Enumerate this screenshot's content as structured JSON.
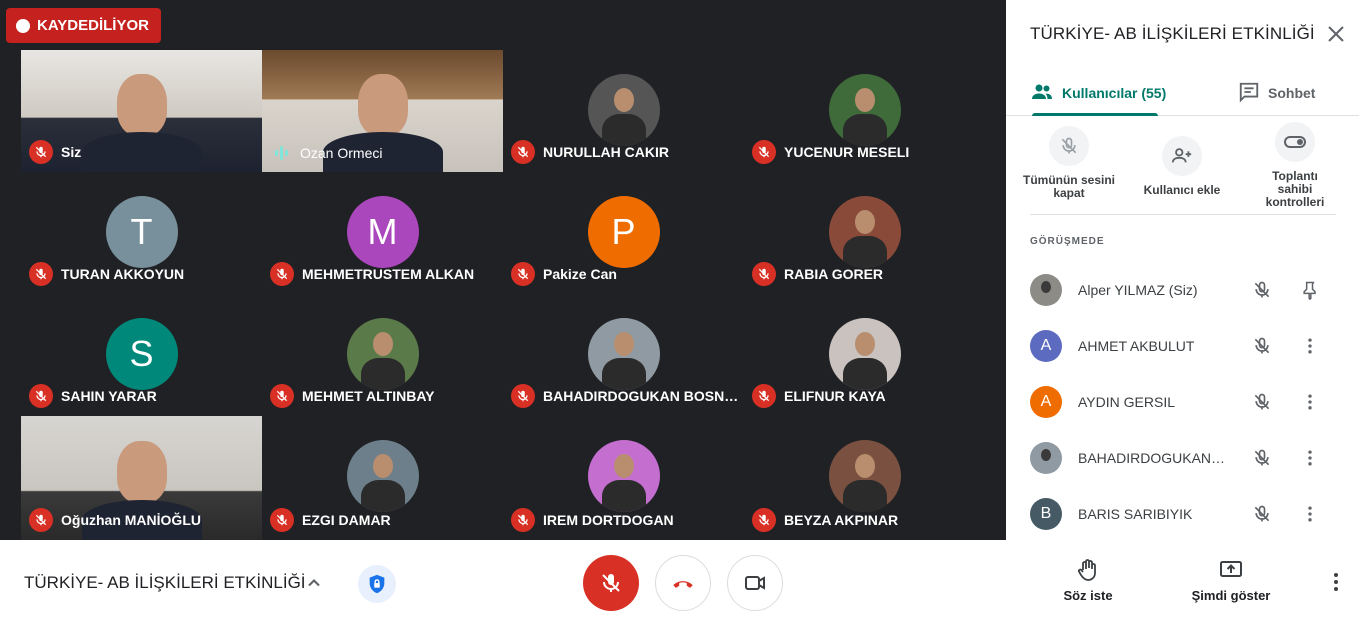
{
  "recording": {
    "label": "KAYDEDİLİYOR"
  },
  "tiles": [
    {
      "name": "Siz",
      "kind": "camera",
      "cam": "cam-a",
      "mic": "off"
    },
    {
      "name": "Ozan Ormeci",
      "kind": "camera",
      "cam": "cam-b",
      "mic": "speaking"
    },
    {
      "name": "NURULLAH CAKIR",
      "kind": "photo",
      "color": "#555555",
      "mic": "off"
    },
    {
      "name": "YUCENUR MESELI",
      "kind": "photo",
      "color": "#3f6b3b",
      "mic": "off"
    },
    {
      "name": "TURAN AKKOYUN",
      "kind": "letter",
      "letter": "T",
      "color": "#78909c",
      "mic": "off"
    },
    {
      "name": "MEHMETRUSTEM ALKAN",
      "kind": "letter",
      "letter": "M",
      "color": "#ab47bc",
      "mic": "off"
    },
    {
      "name": "Pakize Can",
      "kind": "letter",
      "letter": "P",
      "color": "#ef6c00",
      "mic": "off"
    },
    {
      "name": "RABIA GORER",
      "kind": "photo",
      "color": "#8a4a3a",
      "mic": "off"
    },
    {
      "name": "SAHIN YARAR",
      "kind": "letter",
      "letter": "S",
      "color": "#00897b",
      "mic": "off"
    },
    {
      "name": "MEHMET ALTINBAY",
      "kind": "photo",
      "color": "#5b7a4a",
      "mic": "off"
    },
    {
      "name": "BAHADIRDOGUKAN BOSNALI",
      "kind": "photo",
      "color": "#8f9aa3",
      "mic": "off"
    },
    {
      "name": "ELIFNUR KAYA",
      "kind": "photo",
      "color": "#c9c2bf",
      "mic": "off"
    },
    {
      "name": "Oğuzhan MANİOĞLU",
      "kind": "camera",
      "cam": "cam-c",
      "mic": "off"
    },
    {
      "name": "EZGI DAMAR",
      "kind": "photo",
      "color": "#6d7f8a",
      "mic": "off"
    },
    {
      "name": "IREM DORTDOGAN",
      "kind": "photo",
      "color": "#c46fd0",
      "mic": "off"
    },
    {
      "name": "BEYZA AKPINAR",
      "kind": "photo",
      "color": "#7a5140",
      "mic": "off"
    }
  ],
  "panel": {
    "title": "TÜRKİYE- AB İLİŞKİLERİ ETKİNLİĞİ",
    "tab_people": "Kullanıcılar (55)",
    "tab_chat": "Sohbet",
    "actions": {
      "mute_all": "Tümünün sesini kapat",
      "add_user": "Kullanıcı ekle",
      "host_controls": "Toplantı sahibi kontrolleri"
    },
    "section_label": "GÖRÜŞMEDE",
    "participants": [
      {
        "name": "Alper YILMAZ (Siz)",
        "avatar": "photo",
        "letter": "",
        "color": "#8d8b85",
        "trailing": "pin"
      },
      {
        "name": "AHMET AKBULUT",
        "avatar": "letter",
        "letter": "A",
        "color": "#5c6bc0",
        "trailing": "more"
      },
      {
        "name": "AYDIN GERSIL",
        "avatar": "letter",
        "letter": "A",
        "color": "#ef6c00",
        "trailing": "more"
      },
      {
        "name": "BAHADIRDOGUKAN BOSNALI",
        "avatar": "photo",
        "letter": "",
        "color": "#8f9aa3",
        "trailing": "more"
      },
      {
        "name": "BARIS SARIBIYIK",
        "avatar": "letter",
        "letter": "B",
        "color": "#455a64",
        "trailing": "more"
      }
    ]
  },
  "bottom": {
    "meeting_name": "TÜRKİYE- AB İLİŞKİLERİ ETKİNLİĞİ",
    "raise_hand": "Söz iste",
    "present_now": "Şimdi göster"
  },
  "colors": {
    "recording": "#c5221f",
    "mic_off": "#d93025",
    "accent": "#00796b",
    "speaking": "#81e6d9"
  }
}
